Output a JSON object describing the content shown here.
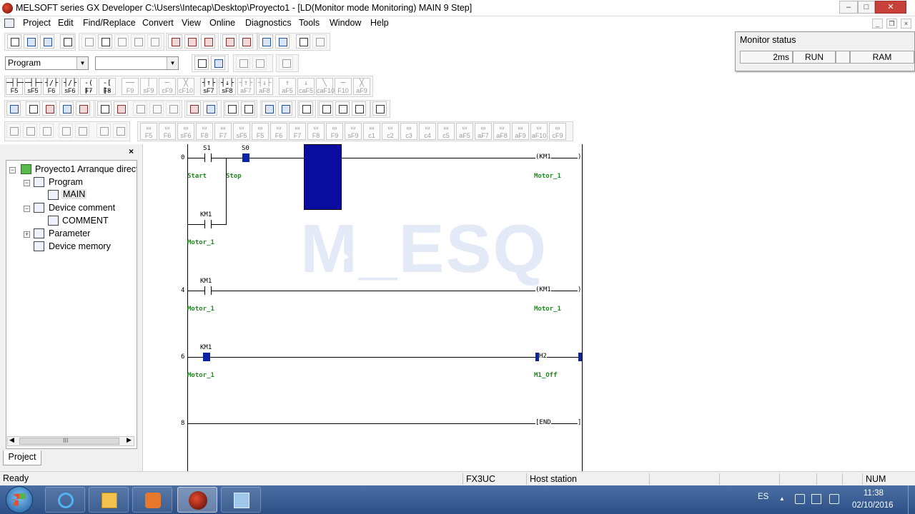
{
  "window": {
    "title": "MELSOFT series GX Developer C:\\Users\\Intecap\\Desktop\\Proyecto1 - [LD(Monitor mode Monitoring)    MAIN    9 Step]",
    "minimize": "–",
    "maximize": "□",
    "close": "✕"
  },
  "menu": {
    "items": [
      "Project",
      "Edit",
      "Find/Replace",
      "Convert",
      "View",
      "Online",
      "Diagnostics",
      "Tools",
      "Window",
      "Help"
    ],
    "mdi_min": "_",
    "mdi_restore": "❐",
    "mdi_close": "×"
  },
  "toolbar": {
    "data_type_select": "Program",
    "data_name_select": "",
    "ladder_buttons": [
      {
        "sym": "─┤├─",
        "key": "F5"
      },
      {
        "sym": "─┤├─",
        "key": "sF5"
      },
      {
        "sym": "┤/├",
        "key": "F6"
      },
      {
        "sym": "┤/├",
        "key": "sF6"
      },
      {
        "sym": "-( )-",
        "key": "F7"
      },
      {
        "sym": "-[ ]-",
        "key": "F8"
      },
      {
        "sym": "──",
        "key": "F9"
      },
      {
        "sym": "│",
        "key": "sF9"
      },
      {
        "sym": "─",
        "key": "cF9"
      },
      {
        "sym": "╳",
        "key": "cF10"
      },
      {
        "sym": "┤↑├",
        "key": "sF7"
      },
      {
        "sym": "┤↓├",
        "key": "sF8"
      },
      {
        "sym": "┤↑├",
        "key": "aF7"
      },
      {
        "sym": "┤↓├",
        "key": "aF8"
      },
      {
        "sym": "↑",
        "key": "aF5"
      },
      {
        "sym": "↓",
        "key": "caF5"
      },
      {
        "sym": "╲",
        "key": "caF10"
      },
      {
        "sym": "─",
        "key": "F10"
      },
      {
        "sym": "╳",
        "key": "aF9"
      }
    ],
    "sfc_buttons": [
      {
        "key": "F5"
      },
      {
        "key": "F6"
      },
      {
        "key": "sF6"
      },
      {
        "key": "F8"
      },
      {
        "key": "F7"
      },
      {
        "key": "sF5"
      },
      {
        "key": "F5"
      },
      {
        "key": "F6"
      },
      {
        "key": "F7"
      },
      {
        "key": "F8"
      },
      {
        "key": "F9"
      },
      {
        "key": "sF9"
      },
      {
        "key": "c1"
      },
      {
        "key": "c2"
      },
      {
        "key": "c3"
      },
      {
        "key": "c4"
      },
      {
        "key": "c5"
      },
      {
        "key": "aF5"
      },
      {
        "key": "aF7"
      },
      {
        "key": "aF8"
      },
      {
        "key": "aF9"
      },
      {
        "key": "aF10"
      },
      {
        "key": "cF9"
      }
    ]
  },
  "monitor": {
    "title": "Monitor status",
    "scan_time": "2ms",
    "cpu_state": "RUN",
    "memory": "RAM"
  },
  "project_tree": {
    "close": "×",
    "root": "Proyecto1 Arranque directo",
    "program": "Program",
    "main": "MAIN",
    "device_comment": "Device comment",
    "comment": "COMMENT",
    "parameter": "Parameter",
    "device_memory": "Device memory",
    "tab": "Project",
    "scroll_mark": "III"
  },
  "ladder": {
    "watermark": "M_ESQ",
    "rung0": {
      "step": "0",
      "c1_dev": "S1",
      "c1_cmt": "Start",
      "c2_dev": "S0",
      "c2_cmt": "Stop",
      "coil_dev": "KM1",
      "coil_cmt": "Motor_1",
      "branch_dev": "KM1",
      "branch_cmt": "Motor_1"
    },
    "rung4": {
      "step": "4",
      "c_dev": "KM1",
      "c_cmt": "Motor_1",
      "coil_dev": "KM1",
      "coil_cmt": "Motor_1"
    },
    "rung6": {
      "step": "6",
      "c_dev": "KM1",
      "c_cmt": "Motor_1",
      "coil_dev": "H2",
      "coil_cmt": "M1_Off"
    },
    "rung8": {
      "step": "8",
      "instr": "END"
    }
  },
  "status": {
    "ready": "Ready",
    "plc": "FX3UC",
    "station": "Host station",
    "num": "NUM"
  },
  "taskbar": {
    "lang": "ES",
    "time": "11:38",
    "date": "02/10/2016",
    "tray_up": "▲"
  }
}
